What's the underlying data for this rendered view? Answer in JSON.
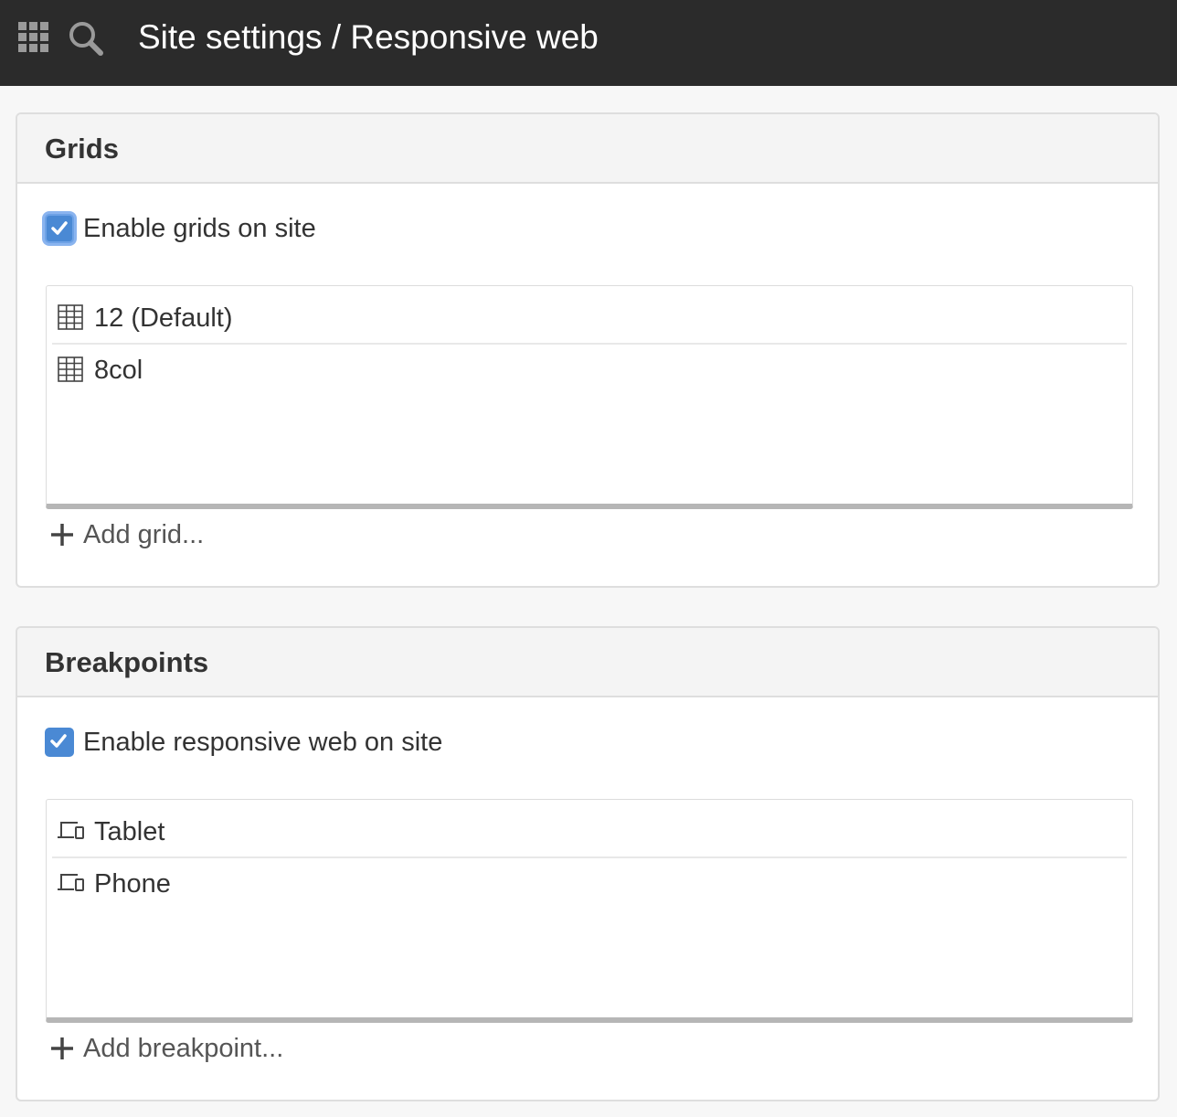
{
  "header": {
    "title": "Site settings / Responsive web",
    "apps_icon": "apps-grid-icon",
    "search_icon": "search-icon",
    "background": "#2b2b2b"
  },
  "grids": {
    "title": "Grids",
    "checkbox_label": "Enable grids on site",
    "checked": true,
    "items": [
      {
        "label": "12 (Default)",
        "icon": "grid-icon"
      },
      {
        "label": "8col",
        "icon": "grid-icon"
      }
    ],
    "add_label": "Add grid..."
  },
  "breakpoints": {
    "title": "Breakpoints",
    "checkbox_label": "Enable responsive web on site",
    "checked": true,
    "items": [
      {
        "label": "Tablet",
        "icon": "devices-icon"
      },
      {
        "label": "Phone",
        "icon": "devices-icon"
      }
    ],
    "add_label": "Add breakpoint..."
  },
  "colors": {
    "checkbox": "#4a89d4",
    "focus_ring": "#8ab4ef"
  }
}
